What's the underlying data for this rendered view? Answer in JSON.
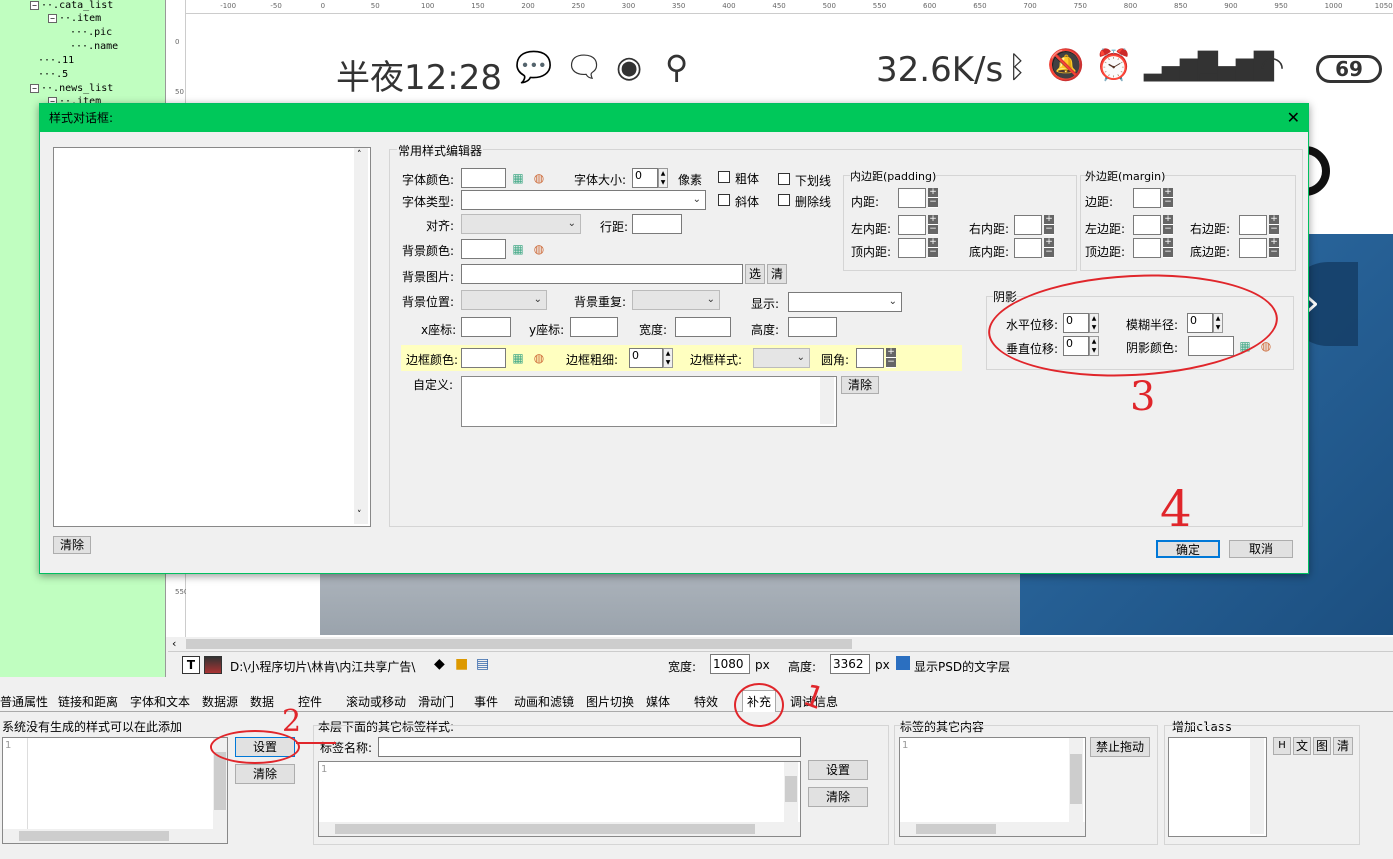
{
  "tree": {
    "nodes": [
      ".cata_list",
      ".item",
      ".pic",
      ".name",
      ".11",
      ".5",
      ".news_list",
      ".item"
    ],
    "expand_mark": "−"
  },
  "ruler": {
    "h_ticks": [
      "-150",
      "-100",
      "-50",
      "0",
      "50",
      "100",
      "150",
      "200",
      "250",
      "300",
      "350",
      "400",
      "450",
      "500",
      "550",
      "600",
      "650",
      "700",
      "750",
      "800",
      "850",
      "900",
      "950",
      "1000",
      "1050"
    ],
    "v_ticks": [
      "0",
      "50",
      "550"
    ]
  },
  "phone": {
    "time": "半夜12:28",
    "speed": "32.6K/s",
    "battery": "69"
  },
  "dialog": {
    "title": "样式对话框:",
    "close": "✕",
    "clear_left": "清除",
    "editor_title": "常用样式编辑器",
    "font_color": "字体颜色:",
    "font_size": "字体大小:",
    "font_size_val": "0",
    "px_unit": "像素",
    "bold": "粗体",
    "underline": "下划线",
    "font_type": "字体类型:",
    "italic": "斜体",
    "strike": "删除线",
    "align": "对齐:",
    "line_height": "行距:",
    "bg_color": "背景颜色:",
    "bg_image": "背景图片:",
    "select_btn": "选",
    "clear_btn": "清",
    "bg_pos": "背景位置:",
    "bg_repeat": "背景重复:",
    "display": "显示:",
    "x": "x座标:",
    "y": "y座标:",
    "width": "宽度:",
    "height": "高度:",
    "border_color": "边框颜色:",
    "border_width": "边框粗细:",
    "border_width_val": "0",
    "border_style": "边框样式:",
    "radius": "圆角:",
    "custom": "自定义:",
    "custom_clear": "清除",
    "padding_title": "内边距(padding)",
    "padding": "内距:",
    "pad_left": "左内距:",
    "pad_right": "右内距:",
    "pad_top": "顶内距:",
    "pad_bottom": "底内距:",
    "margin_title": "外边距(margin)",
    "margin": "边距:",
    "mar_left": "左边距:",
    "mar_right": "右边距:",
    "mar_top": "顶边距:",
    "mar_bottom": "底边距:",
    "shadow_title": "阴影",
    "h_offset": "水平位移:",
    "h_offset_val": "0",
    "blur": "模糊半径:",
    "blur_val": "0",
    "v_offset": "垂直位移:",
    "v_offset_val": "0",
    "shadow_color": "阴影颜色:",
    "ok": "确定",
    "cancel": "取消"
  },
  "pathbar": {
    "path": "D:\\小程序切片\\林肯\\内江共享广告\\",
    "width_label": "宽度:",
    "width_val": "1080",
    "px1": "px",
    "height_label": "高度:",
    "height_val": "3362",
    "px2": "px",
    "psd_text": "显示PSD的文字层"
  },
  "tabs": [
    "普通属性",
    "链接和距离",
    "字体和文本",
    "数据源",
    "数据",
    "控件",
    "滚动或移动",
    "滑动门",
    "事件",
    "动画和滤镜",
    "图片切换",
    "媒体",
    "特效",
    "补充",
    "调试信息"
  ],
  "bottom": {
    "sys_label": "系统没有生成的样式可以在此添加",
    "line1": "1",
    "set": "设置",
    "clear": "清除",
    "other_label": "本层下面的其它标签样式:",
    "tag_name": "标签名称:",
    "set2": "设置",
    "clear2": "清除",
    "tag_other": "标签的其它内容",
    "no_drag": "禁止拖动",
    "add_class": "增加class",
    "btn_h": "H",
    "btn_wen": "文",
    "btn_tu": "图",
    "btn_qing": "清"
  },
  "annotations": {
    "n1": "1",
    "n2": "2",
    "n3": "3",
    "n4": "4"
  },
  "colors": {
    "title_green": "#00c85a",
    "tree_green": "#c0fec0",
    "annotation_red": "#e0262b",
    "highlight_yellow": "#ffffc0"
  }
}
